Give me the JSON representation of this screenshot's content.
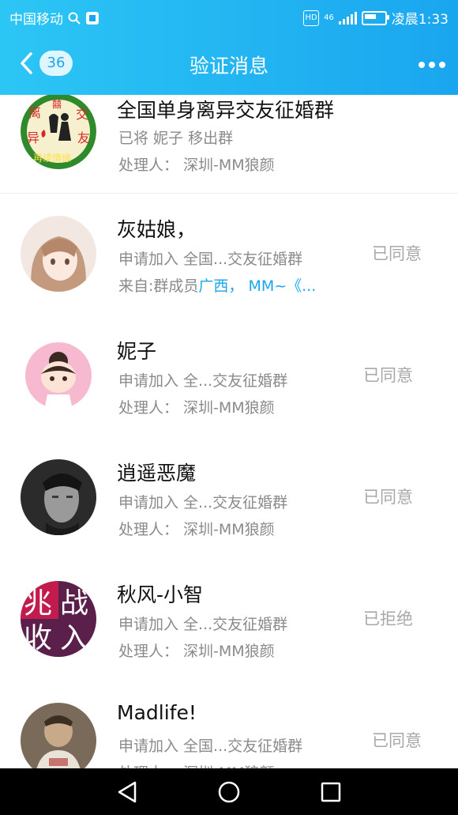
{
  "status_bar": {
    "carrier": "中国移动",
    "hd": "HD",
    "network": "46",
    "time": "凌晨1:33"
  },
  "header": {
    "back_count": "36",
    "title": "验证消息"
  },
  "items": [
    {
      "name": "全国单身离异交友征婚群",
      "line2": "已将 妮子 移出群",
      "line3": "处理人： 深圳-MM狼颜",
      "status": ""
    },
    {
      "name": "灰姑娘，",
      "line2": "申请加入 全国...交友征婚群",
      "line3_prefix": "来自:群成员",
      "line3_highlight": "广西， MM~《...",
      "status": "已同意"
    },
    {
      "name": "妮子",
      "line2": "申请加入 全...交友征婚群",
      "line3": "处理人： 深圳-MM狼颜",
      "status": "已同意"
    },
    {
      "name": "逍遥恶魔",
      "line2": "申请加入 全...交友征婚群",
      "line3": "处理人： 深圳-MM狼颜",
      "status": "已同意"
    },
    {
      "name": "秋风-小智",
      "line2": "申请加入 全...交友征婚群",
      "line3": "处理人： 深圳-MM狼颜",
      "status": "已拒绝"
    },
    {
      "name": "Madlife!",
      "line2": "申请加入 全国...交友征婚群",
      "line3": "处理人： 深圳-MM狼颜",
      "status": "已同意"
    }
  ],
  "avatar_text": {
    "group": [
      "离",
      "囍",
      "交",
      "异",
      "友",
      "再续情缘"
    ],
    "item4": [
      "兆",
      "战",
      "收",
      "入"
    ]
  },
  "colors": {
    "header_start": "#2cc6f5",
    "header_end": "#1aa6ef",
    "link": "#1aa6ef"
  }
}
